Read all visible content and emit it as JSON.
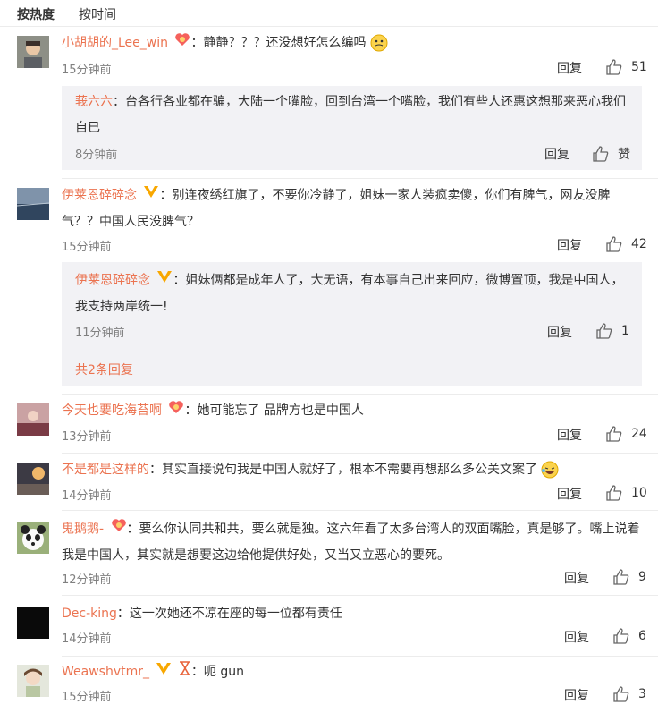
{
  "sort": {
    "hot_label": "按热度",
    "time_label": "按时间"
  },
  "ui": {
    "reply_label": "回复",
    "colon": "：",
    "like_zero_label": "赞"
  },
  "colors": {
    "nickname": "#eb7350",
    "meta": "#808080",
    "subbox_bg": "#f2f2f5"
  },
  "comments": [
    {
      "nickname": "小胡胡的_Lee_win",
      "text": "静静？？？还没想好怎么编吗",
      "time": "15分钟前",
      "likes": "51",
      "badge": "fan-badge-icon",
      "trailing_emoji": "thinking-emoji-icon",
      "replies": [
        {
          "nickname": "莪六六",
          "text": "台各行各业都在骗，大陆一个嘴脸，回到台湾一个嘴脸，我们有些人还惠这想那来恶心我们自已",
          "time": "8分钟前",
          "likes": "赞"
        }
      ]
    },
    {
      "nickname": "伊莱恩碎碎念",
      "text": "别连夜绣红旗了，不要你冷静了，姐妹一家人装疯卖傻，你们有脾气，网友没脾气？？中国人民没脾气？",
      "time": "15分钟前",
      "likes": "42",
      "badge": "verified-v-icon",
      "replies": [
        {
          "nickname": "伊莱恩碎碎念",
          "text": "姐妹俩都是成年人了，大无语，有本事自己出来回应，微博置顶，我是中国人，我支持两岸统一!",
          "time": "11分钟前",
          "likes": "1"
        }
      ],
      "more_replies": "共2条回复"
    },
    {
      "nickname": "今天也要吃海苔啊",
      "text": "她可能忘了 品牌方也是中国人",
      "time": "13分钟前",
      "likes": "24",
      "badge": "fan-badge-icon"
    },
    {
      "nickname": "不是都是这样的",
      "text": "其实直接说句我是中国人就好了，根本不需要再想那么多公关文案了",
      "time": "14分钟前",
      "likes": "10",
      "trailing_emoji": "laughing-emoji-icon"
    },
    {
      "nickname": "鬼鹅鹅-",
      "text": "要么你认同共和共，要么就是独。这六年看了太多台湾人的双面嘴脸，真是够了。嘴上说着我是中国人，其实就是想要这边给他提供好处，又当又立恶心的要死。",
      "time": "12分钟前",
      "likes": "9",
      "badge": "fan-badge-icon"
    },
    {
      "nickname": "Dec-king",
      "text": "这一次她还不凉在座的每一位都有责任",
      "time": "14分钟前",
      "likes": "6"
    },
    {
      "nickname": "Weawshvtmr_",
      "text": "呃 gun",
      "time": "15分钟前",
      "likes": "3",
      "badge": "verified-v-icon"
    }
  ]
}
